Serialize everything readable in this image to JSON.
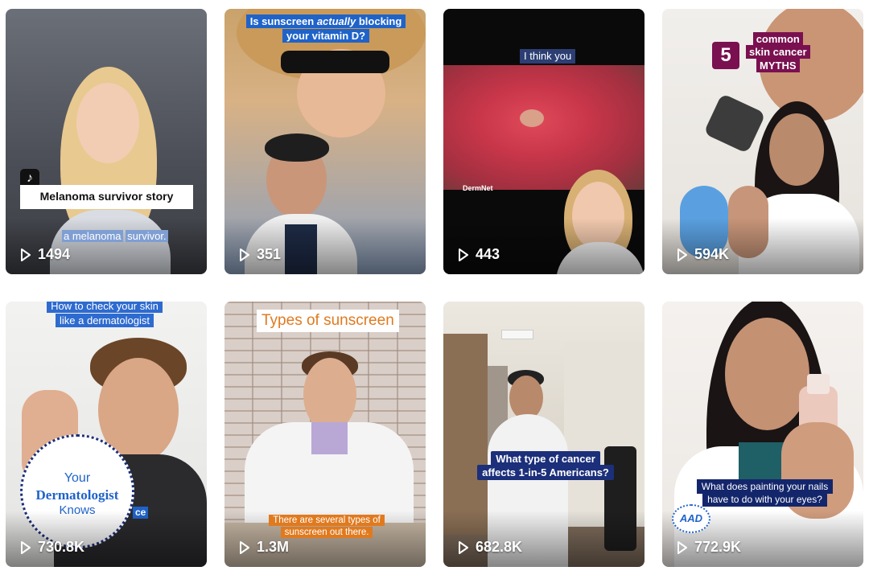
{
  "videos": [
    {
      "views": "1494",
      "captions": {
        "title": "Melanoma survivor story",
        "subtitle_a": "a melanoma",
        "subtitle_b": "survivor."
      }
    },
    {
      "views": "351",
      "captions": {
        "line1_a": "Is sunscreen ",
        "line1_em": "actually",
        "line1_b": " blocking",
        "line2": "your vitamin D?"
      }
    },
    {
      "views": "443",
      "captions": {
        "top": "I think you",
        "logo": "DermNet"
      }
    },
    {
      "views": "594K",
      "captions": {
        "number": "5",
        "line1": "common",
        "line2": "skin cancer",
        "line3": "MYTHS"
      }
    },
    {
      "views": "730.8K",
      "captions": {
        "line1": "How to check your skin",
        "line2": "like a dermatologist",
        "badge1": "Your",
        "badge2": "Dermatologist",
        "badge3": "Knows",
        "side": "ce"
      }
    },
    {
      "views": "1.3M",
      "captions": {
        "top": "Types of sunscreen",
        "bottom1": "There are several types of",
        "bottom2": "sunscreen out there."
      }
    },
    {
      "views": "682.8K",
      "captions": {
        "line1": "What type of cancer",
        "line2": "affects 1-in-5 Americans?"
      }
    },
    {
      "views": "772.9K",
      "captions": {
        "line1": "What does painting your nails",
        "line2": "have to do with your eyes?",
        "logo": "AAD"
      }
    }
  ],
  "icons": {
    "play": "play-icon",
    "tiktok": "tiktok-logo-icon"
  },
  "colors": {
    "caption_blue": "#1f63c9",
    "caption_navy": "#14266b",
    "caption_orange": "#e07a1f",
    "myths_purple": "#7a1050"
  }
}
